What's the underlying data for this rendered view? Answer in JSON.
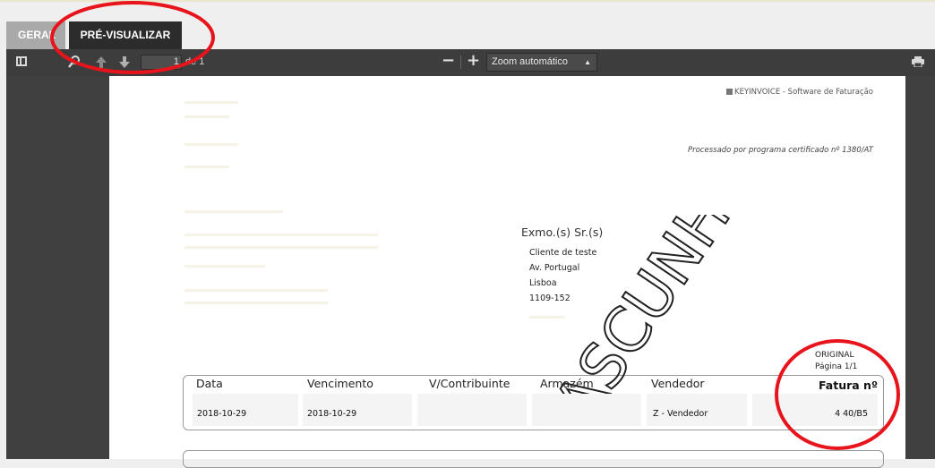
{
  "tabs": [
    {
      "label": "GERAL",
      "active": false
    },
    {
      "label": "PRÉ-VISUALIZAR",
      "active": true
    }
  ],
  "toolbar": {
    "page_number": "1",
    "page_of": "de 1",
    "zoom_out": "−",
    "zoom_in": "+",
    "zoom_value": "Zoom automático",
    "icons": [
      "sidebar-toggle-icon",
      "search-icon",
      "arrow-up-icon",
      "arrow-down-icon",
      "print-icon"
    ]
  },
  "document": {
    "brand": "KEYINVOICE - Software de Faturação",
    "certified": "Processado por programa certificado nº 1380/AT",
    "greeting": "Exmo.(s) Sr.(s)",
    "client": [
      "Cliente de teste",
      "Av. Portugal",
      "Lisboa",
      "1109-152"
    ],
    "original": "ORIGINAL",
    "page_label": "Página 1/1",
    "headers": [
      "Data",
      "Vencimento",
      "V/Contribuinte",
      "Armazém",
      "Vendedor",
      "Fatura nº"
    ],
    "values": {
      "data": "2018-10-29",
      "vencimento": "2018-10-29",
      "vendedor": "Z - Vendedor",
      "fatura": "4 40/B5"
    },
    "watermark": "RASCUNHO"
  },
  "annotation_color": "#e8141c"
}
